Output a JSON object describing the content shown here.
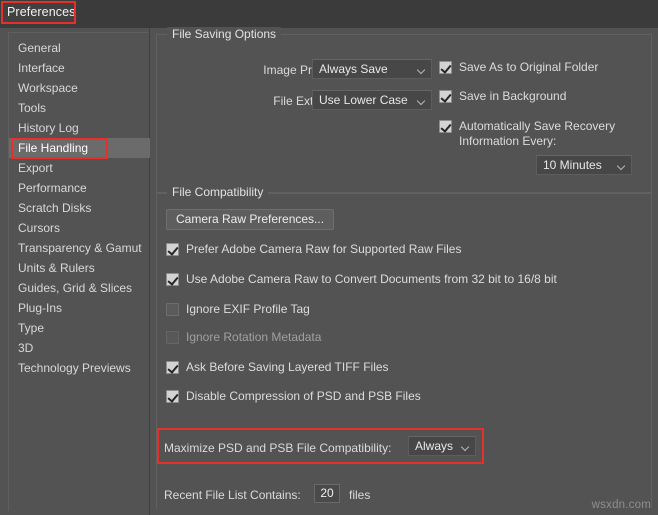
{
  "window": {
    "title": "Preferences"
  },
  "sidebar": {
    "items": [
      {
        "label": "General",
        "selected": false
      },
      {
        "label": "Interface",
        "selected": false
      },
      {
        "label": "Workspace",
        "selected": false
      },
      {
        "label": "Tools",
        "selected": false
      },
      {
        "label": "History Log",
        "selected": false
      },
      {
        "label": "File Handling",
        "selected": true
      },
      {
        "label": "Export",
        "selected": false
      },
      {
        "label": "Performance",
        "selected": false
      },
      {
        "label": "Scratch Disks",
        "selected": false
      },
      {
        "label": "Cursors",
        "selected": false
      },
      {
        "label": "Transparency & Gamut",
        "selected": false
      },
      {
        "label": "Units & Rulers",
        "selected": false
      },
      {
        "label": "Guides, Grid & Slices",
        "selected": false
      },
      {
        "label": "Plug-Ins",
        "selected": false
      },
      {
        "label": "Type",
        "selected": false
      },
      {
        "label": "3D",
        "selected": false
      },
      {
        "label": "Technology Previews",
        "selected": false
      }
    ]
  },
  "file_saving_options": {
    "group_label": "File Saving Options",
    "image_previews_label": "Image Previews:",
    "image_previews_value": "Always Save",
    "file_extension_label": "File Extension:",
    "file_extension_value": "Use Lower Case",
    "save_as_original_folder_label": "Save As to Original Folder",
    "save_as_original_folder_checked": true,
    "save_in_background_label": "Save in Background",
    "save_in_background_checked": true,
    "auto_save_recovery_line1": "Automatically Save Recovery",
    "auto_save_recovery_line2": "Information Every:",
    "auto_save_recovery_checked": true,
    "recovery_interval_value": "10 Minutes"
  },
  "file_compatibility": {
    "group_label": "File Compatibility",
    "camera_raw_button": "Camera Raw Preferences...",
    "checkboxes": [
      {
        "label": "Prefer Adobe Camera Raw for Supported Raw Files",
        "checked": true,
        "dim": false
      },
      {
        "label": "Use Adobe Camera Raw to Convert Documents from 32 bit to 16/8 bit",
        "checked": true,
        "dim": false
      },
      {
        "label": "Ignore EXIF Profile Tag",
        "checked": false,
        "dim": false
      },
      {
        "label": "Ignore Rotation Metadata",
        "checked": false,
        "dim": true
      },
      {
        "label": "Ask Before Saving Layered TIFF Files",
        "checked": true,
        "dim": false
      },
      {
        "label": "Disable Compression of PSD and PSB Files",
        "checked": true,
        "dim": false
      }
    ],
    "maximize_label": "Maximize PSD and PSB File Compatibility:",
    "maximize_value": "Always",
    "recent_file_list_label": "Recent File List Contains:",
    "recent_file_list_value": "20",
    "recent_file_list_suffix": "files"
  },
  "annotations": {
    "highlight_color": "#e8302a"
  },
  "watermark": {
    "text": "wsxdn.com"
  }
}
